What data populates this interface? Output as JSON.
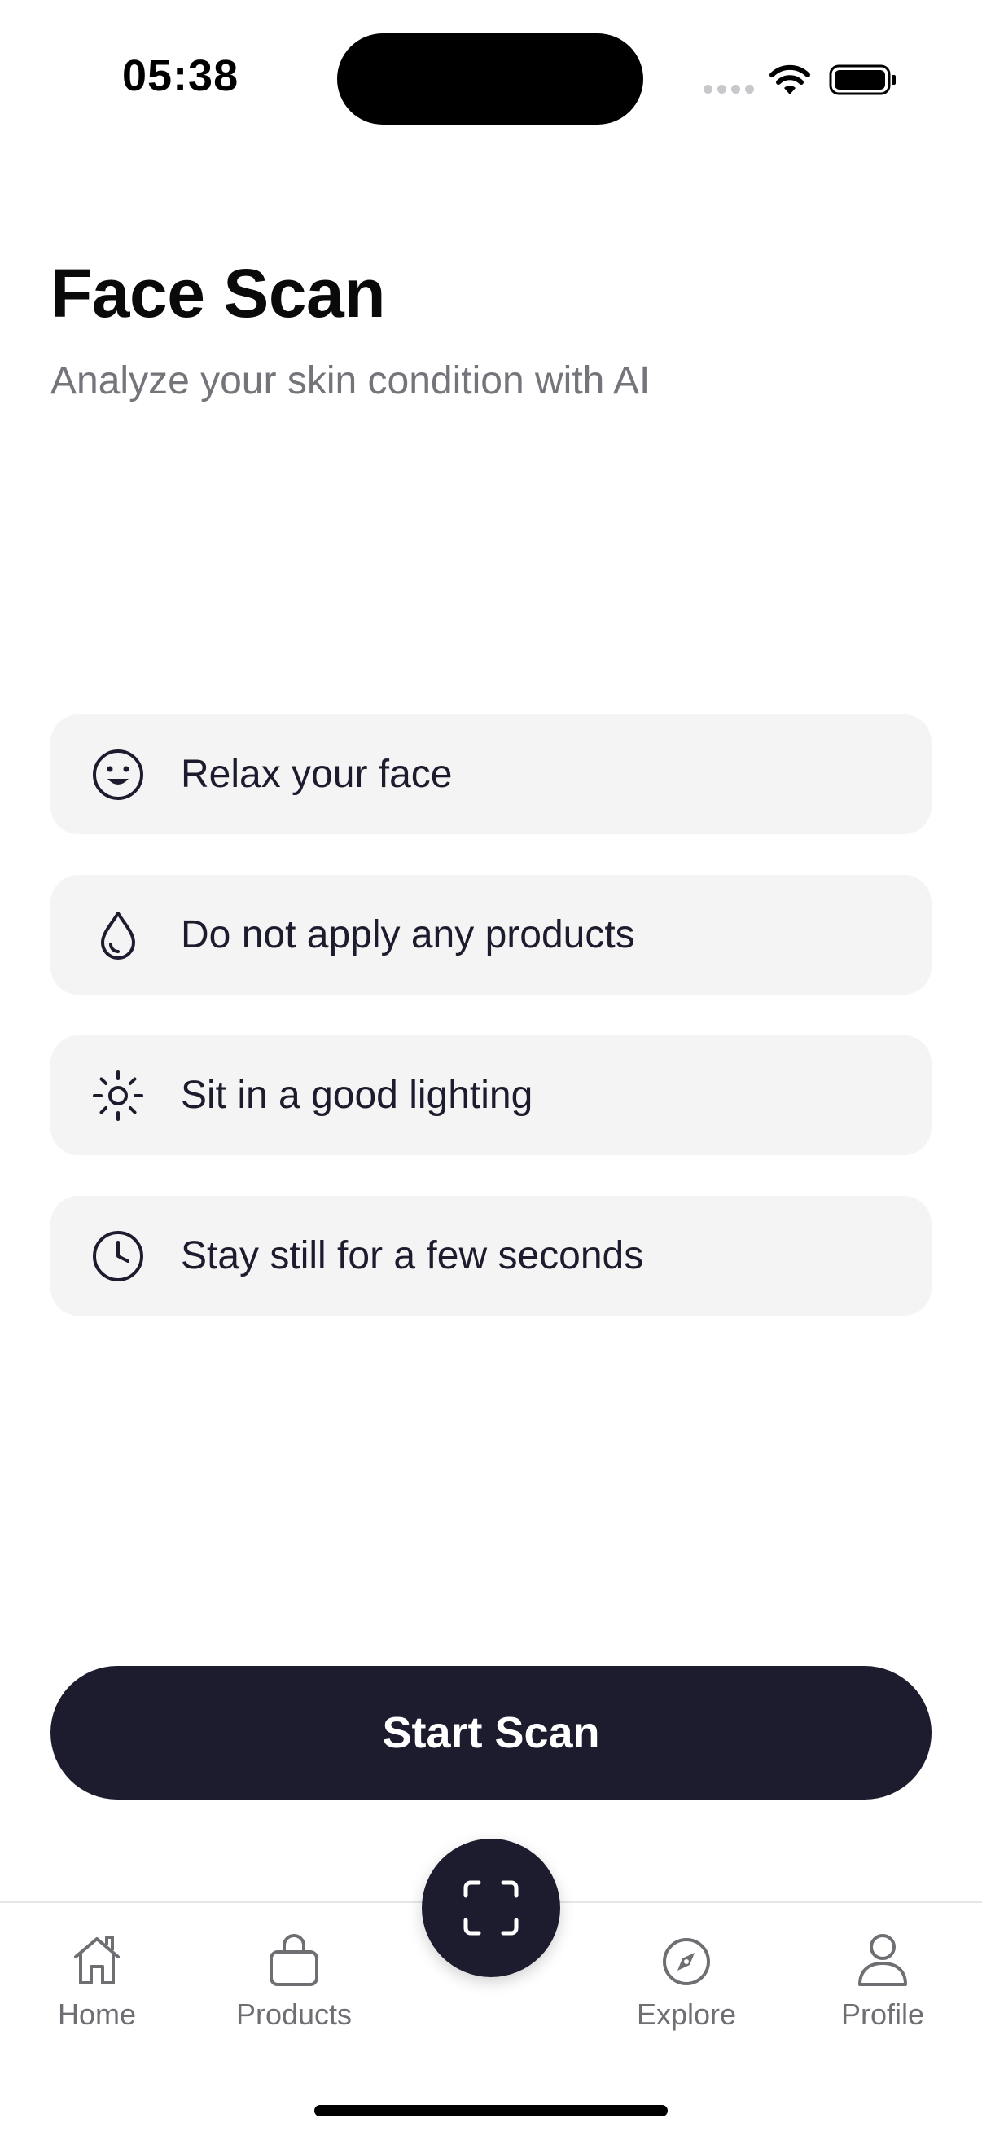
{
  "status_bar": {
    "time": "05:38"
  },
  "header": {
    "title": "Face Scan",
    "subtitle": "Analyze your skin condition with AI"
  },
  "tips": [
    {
      "icon": "smile-icon",
      "label": "Relax your face"
    },
    {
      "icon": "droplet-icon",
      "label": "Do not apply any products"
    },
    {
      "icon": "sun-icon",
      "label": "Sit in a good lighting"
    },
    {
      "icon": "clock-icon",
      "label": "Stay still for a few seconds"
    }
  ],
  "start_button": {
    "label": "Start Scan"
  },
  "tab_bar": {
    "items": [
      {
        "icon": "home-icon",
        "label": "Home"
      },
      {
        "icon": "shopping-bag-icon",
        "label": "Products"
      },
      {
        "icon": "scan-icon",
        "label": ""
      },
      {
        "icon": "compass-icon",
        "label": "Explore"
      },
      {
        "icon": "user-icon",
        "label": "Profile"
      }
    ]
  },
  "colors": {
    "primary_dark": "#1c1c2e",
    "card_background": "#f4f4f4",
    "subtitle_gray": "#74747a",
    "tab_inactive": "#6e6e73"
  }
}
